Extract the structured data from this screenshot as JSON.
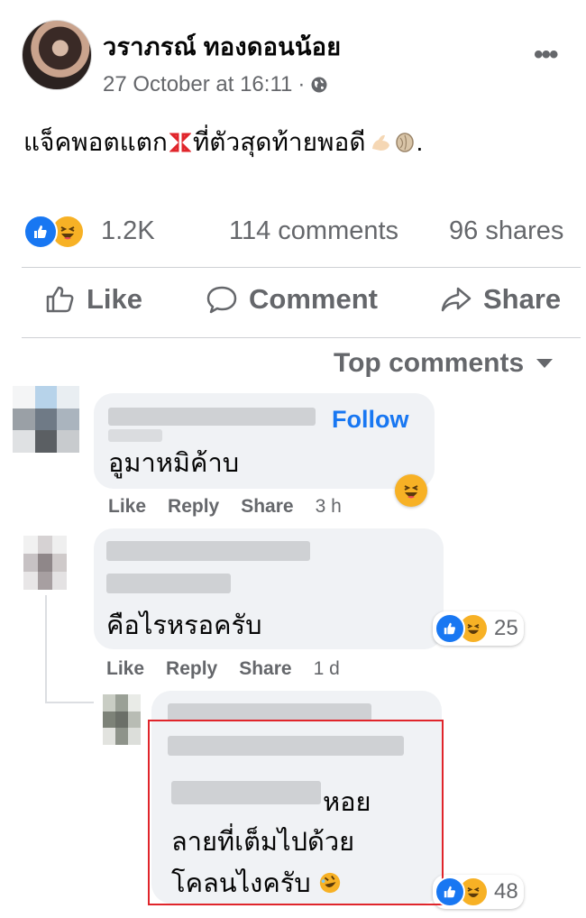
{
  "post": {
    "author": "วราภรณ์ ทองดอนน้อย",
    "timestamp": "27 October at 16:11",
    "separator": "·",
    "more_icon": "more-horizontal-icon",
    "text_part1": "แจ็คพอตแตก",
    "text_part2": "ที่ตัวสุดท้ายพอดี",
    "text_end": "."
  },
  "stats": {
    "reactions_count": "1.2K",
    "comments": "114 comments",
    "shares": "96 shares"
  },
  "actions": {
    "like": "Like",
    "comment": "Comment",
    "share": "Share"
  },
  "sort": {
    "label": "Top comments"
  },
  "comments": [
    {
      "text": "อูมาหมิค้าบ",
      "follow": "Follow",
      "like": "Like",
      "reply": "Reply",
      "share": "Share",
      "time": "3 h"
    },
    {
      "text": "คือไรหรอครับ",
      "like": "Like",
      "reply": "Reply",
      "share": "Share",
      "time": "1 d",
      "reaction_count": "25"
    },
    {
      "text_line1": "หอย",
      "text_line2": "ลายที่เต็มไปด้วย",
      "text_line3": "โคลนไงครับ",
      "reaction_count": "48"
    }
  ],
  "colors": {
    "accent": "#1877f2",
    "secondary_text": "#65676b",
    "highlight_box": "#e0252b",
    "bubble_bg": "#f0f2f5"
  }
}
